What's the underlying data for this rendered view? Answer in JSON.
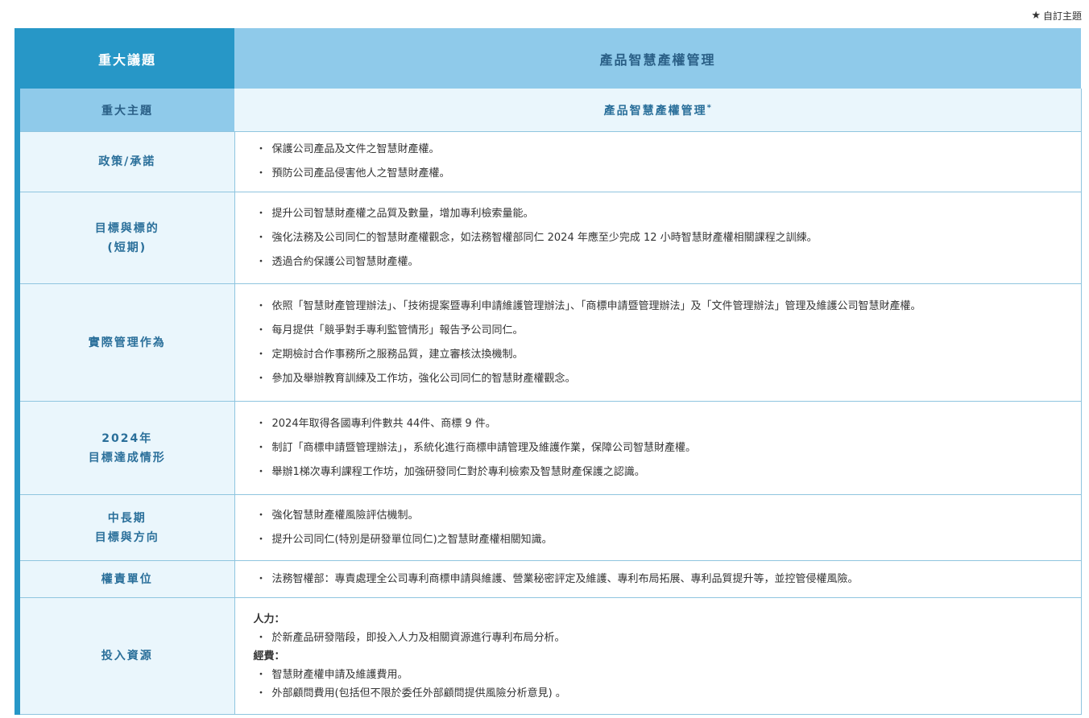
{
  "legend": {
    "icon": "star-icon",
    "text": "自訂主題"
  },
  "header": {
    "left": "重大議題",
    "right": "產品智慧產權管理"
  },
  "subheader": {
    "left": "重大主題",
    "right": "產品智慧產權管理",
    "mark": "*"
  },
  "rows": [
    {
      "label": [
        "政策/承諾"
      ],
      "items": [
        "保護公司產品及文件之智慧財產權。",
        "預防公司產品侵害他人之智慧財產權。"
      ]
    },
    {
      "label": [
        "目標與標的",
        "(短期)"
      ],
      "items": [
        "提升公司智慧財產權之品質及數量，增加專利檢索量能。",
        "強化法務及公司同仁的智慧財產權觀念，如法務智權部同仁 2024 年應至少完成 12 小時智慧財產權相關課程之訓練。",
        "透過合約保護公司智慧財產權。"
      ]
    },
    {
      "label": [
        "實際管理作為"
      ],
      "items": [
        "依照「智慧財產管理辦法」、「技術提案暨專利申請維護管理辦法」、「商標申請暨管理辦法」及「文件管理辦法」管理及維護公司智慧財產權。",
        "每月提供「競爭對手專利監管情形」報告予公司同仁。",
        "定期檢討合作事務所之服務品質，建立審核汰換機制。",
        "參加及舉辦教育訓練及工作坊，強化公司同仁的智慧財產權觀念。"
      ]
    },
    {
      "label": [
        "2024年",
        "目標達成情形"
      ],
      "items": [
        "2024年取得各國專利件數共 44件、商標 9 件。",
        "制訂「商標申請暨管理辦法」，系統化進行商標申請管理及維護作業，保障公司智慧財產權。",
        "舉辦1梯次專利課程工作坊，加強研發同仁對於專利檢索及智慧財產保護之認識。"
      ]
    },
    {
      "label": [
        "中長期",
        "目標與方向"
      ],
      "items": [
        "強化智慧財產權風險評估機制。",
        "提升公司同仁(特別是研發單位同仁)之智慧財產權相關知識。"
      ]
    },
    {
      "label": [
        "權責單位"
      ],
      "items": [
        "法務智權部：專責處理全公司專利商標申請與維護、營業秘密評定及維護、專利布局拓展、專利品質提升等，並控管侵權風險。"
      ]
    }
  ],
  "resources": {
    "label": "投入資源",
    "manpower_title": "人力：",
    "manpower_items": [
      "於新產品研發階段，即投入人力及相關資源進行專利布局分析。"
    ],
    "budget_title": "經費：",
    "budget_items": [
      "智慧財產權申請及維護費用。",
      "外部顧問費用(包括但不限於委任外部顧問提供風險分析意見) 。"
    ]
  }
}
